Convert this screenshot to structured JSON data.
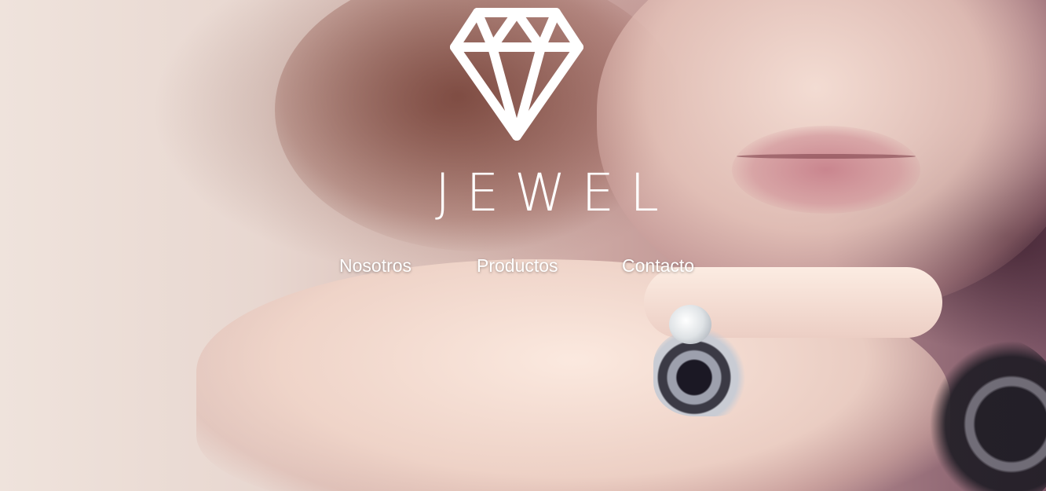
{
  "brand": {
    "title": "JEWEL",
    "logo_icon": "diamond-icon"
  },
  "nav": {
    "items": [
      {
        "label": "Nosotros"
      },
      {
        "label": "Productos"
      },
      {
        "label": "Contacto"
      }
    ]
  },
  "colors": {
    "text": "#ffffff",
    "background_light": "#efe3dc",
    "background_dark": "#7c5566"
  },
  "hero": {
    "background": "photo of a woman with curly hair resting her chin on her hand, wearing a jeweled ring and necklace"
  }
}
